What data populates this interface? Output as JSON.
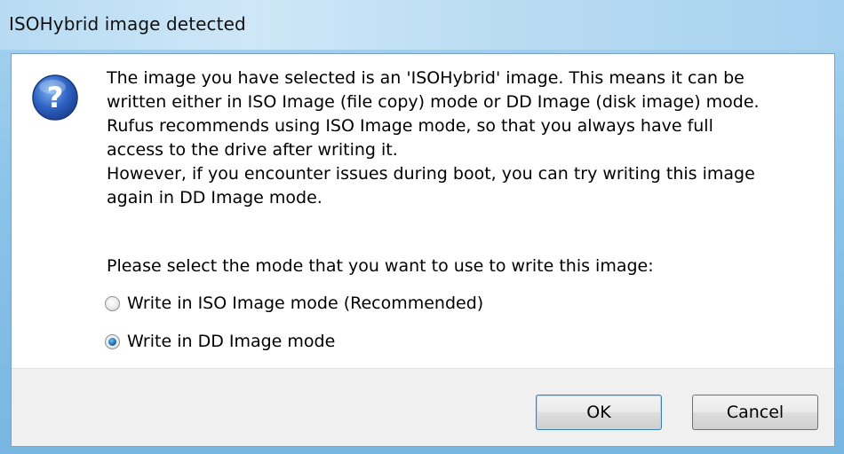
{
  "dialog": {
    "title": "ISOHybrid image detected",
    "message_lines": [
      "The image you have selected is an 'ISOHybrid' image. This means it can be",
      "written either in ISO Image (file copy) mode or DD Image (disk image) mode.",
      "Rufus recommends using ISO Image mode, so that you always have full",
      "access to the drive after writing it.",
      "However, if you encounter issues during boot, you can try writing this image",
      "again in DD Image mode."
    ],
    "prompt": "Please select the mode that you want to use to write this image:",
    "options": [
      {
        "label": "Write in ISO Image mode (Recommended)",
        "selected": false
      },
      {
        "label": "Write in DD Image mode",
        "selected": true
      }
    ],
    "buttons": {
      "ok": "OK",
      "cancel": "Cancel"
    },
    "icon": "question-icon"
  }
}
